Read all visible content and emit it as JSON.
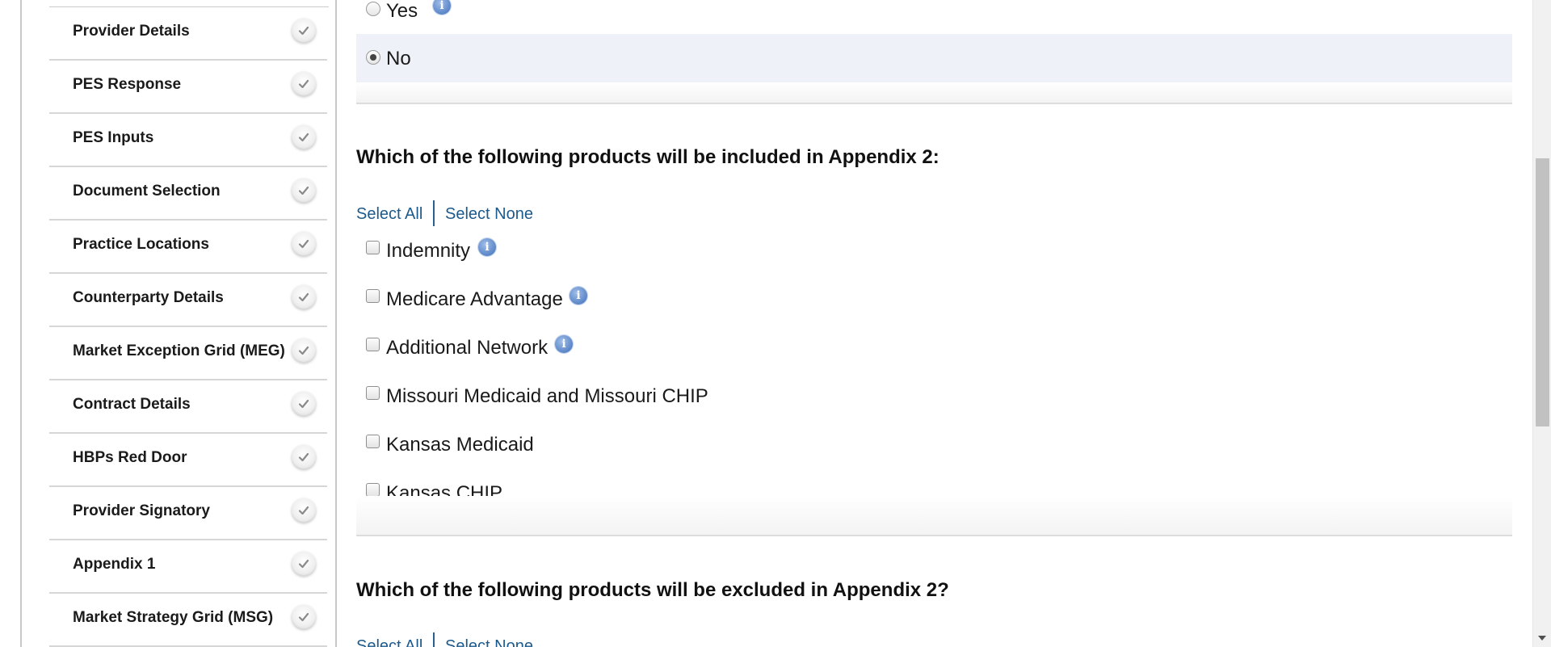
{
  "sidebar": {
    "items": [
      {
        "label": "Provider Details",
        "icon": "check-icon"
      },
      {
        "label": "PES Response",
        "icon": "check-icon"
      },
      {
        "label": "PES Inputs",
        "icon": "check-icon"
      },
      {
        "label": "Document Selection",
        "icon": "check-icon"
      },
      {
        "label": "Practice Locations",
        "icon": "check-icon"
      },
      {
        "label": "Counterparty Details",
        "icon": "check-icon"
      },
      {
        "label": "Market Exception Grid (MEG)",
        "icon": "check-icon"
      },
      {
        "label": "Contract Details",
        "icon": "check-icon"
      },
      {
        "label": "HBPs Red Door",
        "icon": "check-icon"
      },
      {
        "label": "Provider Signatory",
        "icon": "check-icon"
      },
      {
        "label": "Appendix 1",
        "icon": "check-icon"
      },
      {
        "label": "Market Strategy Grid (MSG)",
        "icon": "check-icon"
      }
    ]
  },
  "radio_group": {
    "yes_label": "Yes",
    "no_label": "No",
    "selected": "No"
  },
  "included_section": {
    "question": "Which of the following products will be included in Appendix 2:",
    "select_all": "Select All",
    "select_none": "Select None",
    "options": [
      {
        "label": "Indemnity",
        "checked": false,
        "has_info": true
      },
      {
        "label": "Medicare Advantage",
        "checked": false,
        "has_info": true
      },
      {
        "label": "Additional Network",
        "checked": false,
        "has_info": true
      },
      {
        "label": "Missouri Medicaid and Missouri CHIP",
        "checked": false,
        "has_info": false
      },
      {
        "label": "Kansas Medicaid",
        "checked": false,
        "has_info": false
      },
      {
        "label": "Kansas CHIP",
        "checked": false,
        "has_info": false
      }
    ]
  },
  "excluded_section": {
    "question": "Which of the following products will be excluded in Appendix 2?",
    "select_all": "Select All",
    "select_none": "Select None"
  },
  "icons": {
    "info_glyph": "i"
  },
  "colors": {
    "link": "#1d5a8c",
    "info_icon": "#5b86c8",
    "selected_row": "#eef1f7"
  }
}
